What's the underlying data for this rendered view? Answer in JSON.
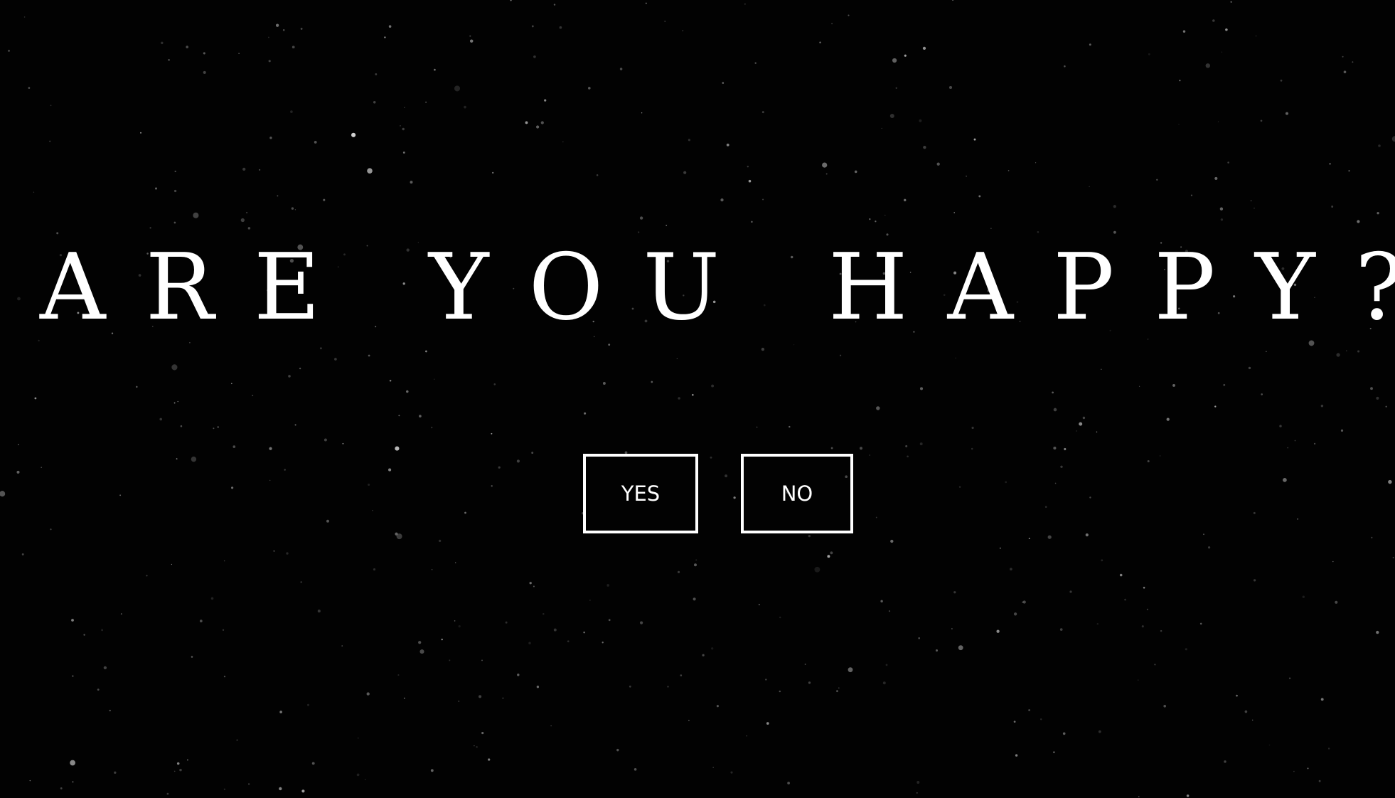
{
  "background_color": "#020202",
  "text_color": "#ffffff",
  "question": "ARE YOU HAPPY?",
  "buttons": {
    "yes_label": "YES",
    "no_label": "NO"
  }
}
